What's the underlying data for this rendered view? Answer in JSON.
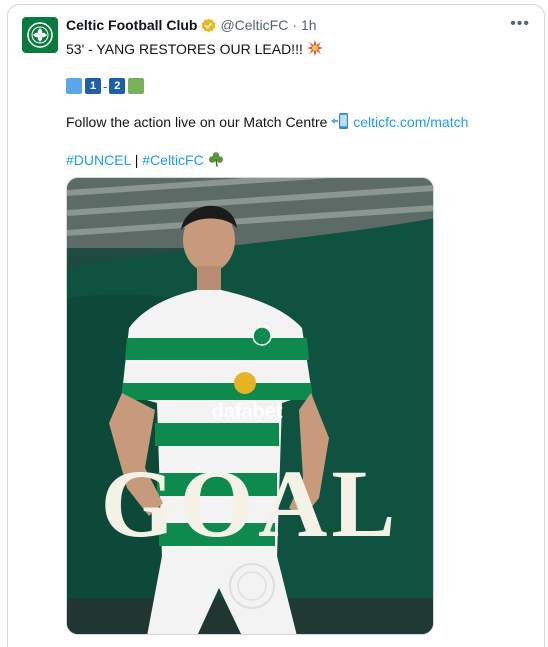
{
  "tweet": {
    "display_name": "Celtic Football Club",
    "handle": "@CelticFC",
    "separator": "·",
    "time": "1h",
    "more_label": "•••",
    "headline": "53' - YANG RESTORES OUR LEAD!!!",
    "score": {
      "home": "1",
      "away": "2",
      "dash": "-"
    },
    "follow_text": "Follow the action live on our Match Centre",
    "match_link": "celticfc.com/match",
    "hashtag1": "#DUNCEL",
    "hashtag_sep": "|",
    "hashtag2": "#CelticFC",
    "image_overlay": "GOAL",
    "sponsor": "dafabet"
  },
  "colors": {
    "link": "#1d9bf0",
    "celtic_green": "#0b7a3e",
    "verified": "#e8b923"
  },
  "icons": [
    "celtic-crest-icon",
    "verified-badge-icon",
    "more-icon",
    "explosion-icon",
    "mobile-phone-icon",
    "shamrock-icon"
  ]
}
